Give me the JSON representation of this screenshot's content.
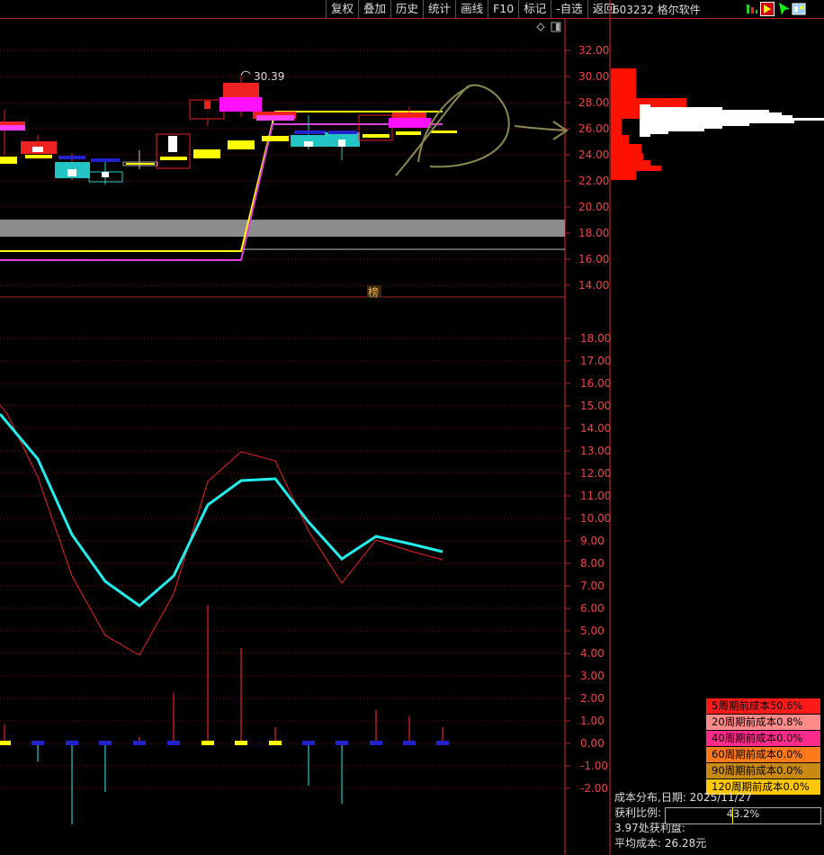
{
  "toolbar": {
    "items": [
      "复权",
      "叠加",
      "历史",
      "统计",
      "画线",
      "F10",
      "标记",
      "-自选",
      "返回"
    ]
  },
  "stock": {
    "code": "603232",
    "name": "格尔软件"
  },
  "icons": [
    "bar-chart-icon",
    "play-icon",
    "arrow-icon",
    "window-icon"
  ],
  "price_axis": [
    "32.00",
    "30.00",
    "28.00",
    "26.00",
    "24.00",
    "22.00",
    "20.00",
    "18.00",
    "16.00",
    "14.00"
  ],
  "indicator_axis": [
    "18.00",
    "17.00",
    "16.00",
    "15.00",
    "14.00",
    "13.00",
    "12.00",
    "11.00",
    "10.00",
    "9.00",
    "8.00",
    "7.00",
    "6.00",
    "5.00",
    "4.00",
    "3.00",
    "2.00",
    "1.00",
    "0.00",
    "-1.00",
    "-2.00"
  ],
  "annotations": {
    "high_label": "30.39",
    "badge": "榜"
  },
  "chip_distribution": {
    "rows": [
      {
        "label": "5周期前成本50.6%",
        "color": "#ff1a1a"
      },
      {
        "label": "20周期前成本0.8%",
        "color": "#ff8a8a"
      },
      {
        "label": "40周期前成本0.0%",
        "color": "#ff2a8a"
      },
      {
        "label": "60周期前成本0.0%",
        "color": "#ff7a1a"
      },
      {
        "label": "90周期前成本0.0%",
        "color": "#c88a10"
      },
      {
        "label": "120周期前成本0.0%",
        "color": "#ffc800"
      }
    ],
    "date_line": "成本分布,日期:  2025/11/27",
    "profit_label": "获利比例:",
    "profit_value": "43.2%",
    "profit_ratio": 0.432,
    "profit_at_price": "3.97处获利盘:",
    "avg_cost": "平均成本:  26.28元"
  }
}
